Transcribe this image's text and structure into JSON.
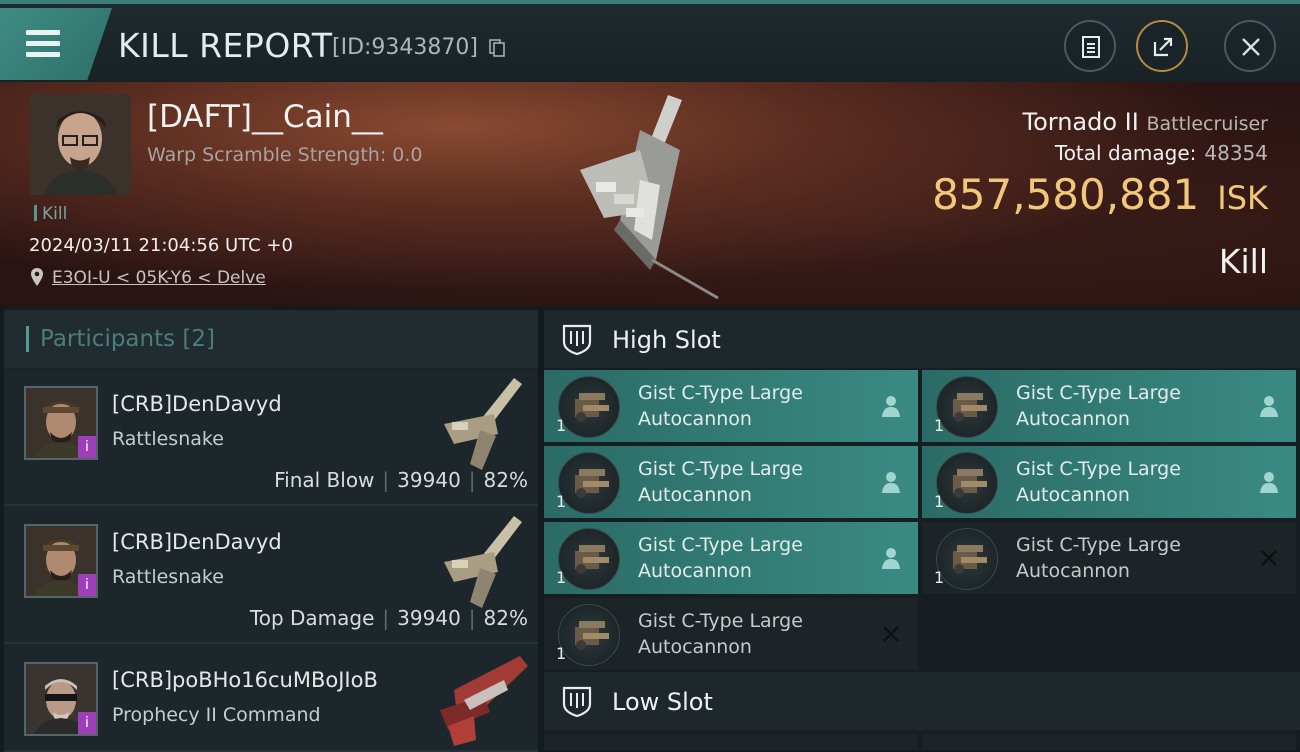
{
  "header": {
    "title": "KILL REPORT",
    "report_id": "[ID:9343870]"
  },
  "victim": {
    "name": "[DAFT]__Cain__",
    "warp_scramble": "Warp Scramble Strength: 0.0",
    "tag": "Kill",
    "timestamp": "2024/03/11 21:04:56 UTC +0",
    "location": "E3OI-U < 05K-Y6 < Delve"
  },
  "ship": {
    "name": "Tornado II",
    "class": "Battlecruiser",
    "total_damage_label": "Total damage:",
    "total_damage": "48354",
    "isk_value": "857,580,881",
    "isk_unit": "ISK",
    "result": "Kill"
  },
  "participants": {
    "title": "Participants [2]",
    "items": [
      {
        "name": "[CRB]DenDavyd",
        "ship": "Rattlesnake",
        "role": "Final Blow",
        "damage": "39940",
        "percent": "82%"
      },
      {
        "name": "[CRB]DenDavyd",
        "ship": "Rattlesnake",
        "role": "Top Damage",
        "damage": "39940",
        "percent": "82%"
      },
      {
        "name": "[CRB]poBHo16cuMBoJIoB",
        "ship": "Prophecy II Command",
        "role": "",
        "damage": "",
        "percent": ""
      }
    ]
  },
  "slots": {
    "high": {
      "title": "High Slot",
      "modules": [
        {
          "line1": "Gist C-Type Large",
          "line2": "Autocannon",
          "qty": "1",
          "status": "fitted"
        },
        {
          "line1": "Gist C-Type Large",
          "line2": "Autocannon",
          "qty": "1",
          "status": "fitted"
        },
        {
          "line1": "Gist C-Type Large",
          "line2": "Autocannon",
          "qty": "1",
          "status": "fitted"
        },
        {
          "line1": "Gist C-Type Large",
          "line2": "Autocannon",
          "qty": "1",
          "status": "fitted"
        },
        {
          "line1": "Gist C-Type Large",
          "line2": "Autocannon",
          "qty": "1",
          "status": "fitted"
        },
        {
          "line1": "Gist C-Type Large",
          "line2": "Autocannon",
          "qty": "1",
          "status": "destroyed"
        },
        {
          "line1": "Gist C-Type Large",
          "line2": "Autocannon",
          "qty": "1",
          "status": "destroyed"
        }
      ]
    },
    "low": {
      "title": "Low Slot"
    }
  },
  "colors": {
    "accent_teal": "#3a8a83",
    "isk_gold": "#f1c77a",
    "badge_purple": "#9d3fb8"
  }
}
